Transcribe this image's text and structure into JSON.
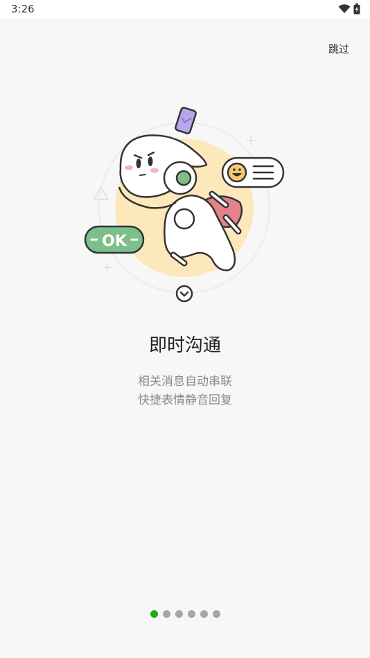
{
  "status_bar": {
    "time": "3:26",
    "icons": [
      "wifi-icon",
      "battery-charging-icon"
    ]
  },
  "skip_label": "跳过",
  "illustration": {
    "ok_badge_text": "OK"
  },
  "title": "即时沟通",
  "description": [
    "相关消息自动串联",
    "快捷表情静音回复"
  ],
  "pager": {
    "total": 6,
    "active_index": 0
  },
  "colors": {
    "active_dot": "#1aad19",
    "inactive_dot": "#a6a6a6",
    "ok_green": "#7dbf8b",
    "circle_yellow": "#fde8bb",
    "cape_pink": "#e4838b",
    "phone_purple": "#b9a6ea"
  }
}
